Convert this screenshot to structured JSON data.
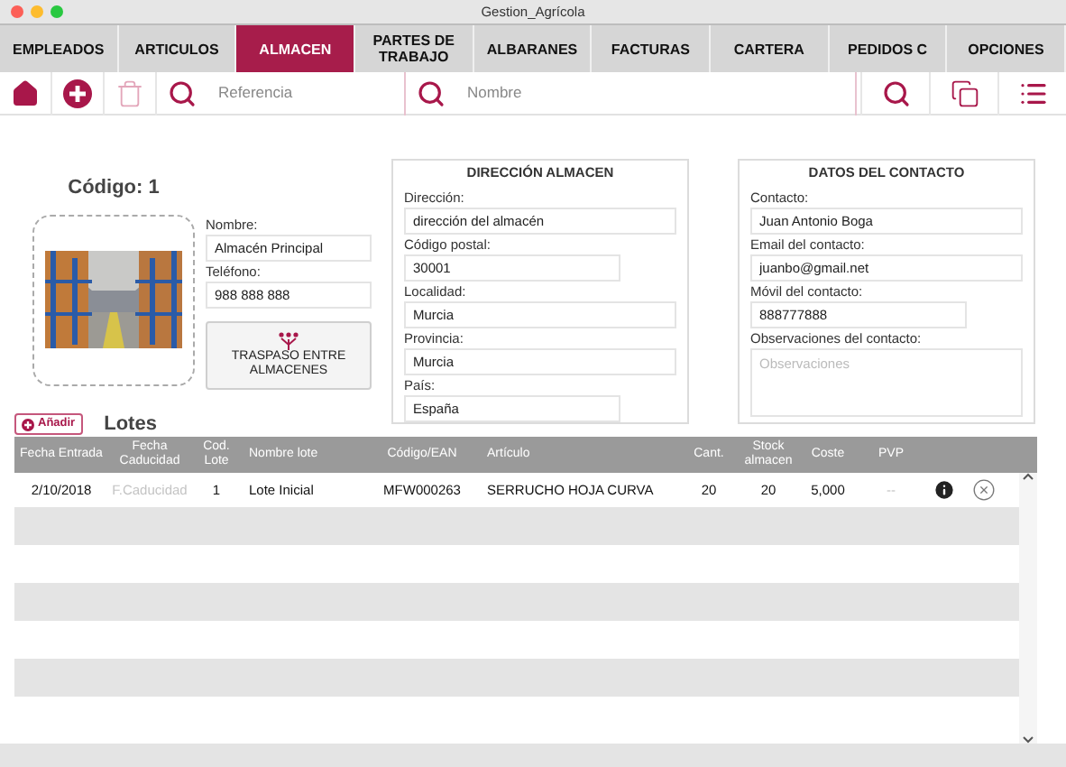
{
  "window": {
    "title": "Gestion_Agrícola"
  },
  "tabs": [
    {
      "label": "EMPLEADOS",
      "selected": false
    },
    {
      "label": "ARTICULOS",
      "selected": false
    },
    {
      "label": "ALMACEN",
      "selected": true
    },
    {
      "label": "PARTES DE TRABAJO",
      "selected": false
    },
    {
      "label": "ALBARANES",
      "selected": false
    },
    {
      "label": "FACTURAS",
      "selected": false
    },
    {
      "label": "CARTERA",
      "selected": false
    },
    {
      "label": "PEDIDOS C",
      "selected": false
    },
    {
      "label": "OPCIONES",
      "selected": false
    }
  ],
  "toolbar": {
    "left_buttons": [
      {
        "kind": "home",
        "disabled": false
      },
      {
        "kind": "add",
        "disabled": false
      },
      {
        "kind": "delete",
        "disabled": true
      }
    ],
    "search_fields": [
      {
        "placeholder": "Referencia"
      },
      {
        "placeholder": "Nombre"
      }
    ],
    "right_buttons": [
      {
        "kind": "search",
        "disabled": false
      },
      {
        "kind": "copy",
        "disabled": false
      },
      {
        "kind": "list",
        "disabled": false
      }
    ]
  },
  "almacen": {
    "code": "Código: 1",
    "fields": [
      {
        "label": "Nombre:",
        "value": "Almacén Principal"
      },
      {
        "label": "Teléfono:",
        "value": "988 888 888"
      }
    ],
    "transfer_button": "TRASPASO ENTRE ALMACENES"
  },
  "direccion": {
    "title": "DIRECCIÓN ALMACEN",
    "fields": [
      {
        "label": "Dirección:",
        "value": "dirección del almacén",
        "kind": "wide"
      },
      {
        "label": "Código postal:",
        "value": "30001",
        "kind": "short"
      },
      {
        "label": "Localidad:",
        "value": "Murcia",
        "kind": "wide"
      },
      {
        "label": "Provincia:",
        "value": "Murcia",
        "kind": "wide"
      },
      {
        "label": "País:",
        "value": "España",
        "kind": "short"
      }
    ]
  },
  "contacto": {
    "title": "DATOS DEL CONTACTO",
    "fields": [
      {
        "label": "Contacto:",
        "value": "Juan Antonio Boga",
        "kind": "wide"
      },
      {
        "label": "Email del contacto:",
        "value": "juanbo@gmail.net",
        "kind": "wide"
      },
      {
        "label": "Móvil del contacto:",
        "value": "888777888",
        "kind": "short"
      },
      {
        "label": "Observaciones del contacto:",
        "placeholder": "Observaciones",
        "kind": "textarea"
      }
    ]
  },
  "lotes": {
    "add_button": "Añadir",
    "title": "Lotes",
    "columns": [
      "Fecha Entrada",
      "Fecha Caducidad",
      "Cod. Lote",
      "Nombre lote",
      "Código/EAN",
      "Artículo",
      "Cant.",
      "Stock almacen",
      "Coste",
      "PVP"
    ],
    "rows": [
      {
        "cells": [
          {
            "text": "2/10/2018",
            "muted": false
          },
          {
            "text": "F.Caducidad",
            "muted": true
          },
          {
            "text": "1",
            "muted": false
          },
          {
            "text": "Lote Inicial",
            "muted": false
          },
          {
            "text": "MFW000263",
            "muted": false
          },
          {
            "text": "SERRUCHO HOJA CURVA",
            "muted": false
          },
          {
            "text": "20",
            "muted": false
          },
          {
            "text": "20",
            "muted": false
          },
          {
            "text": "5,000",
            "muted": false
          },
          {
            "text": "--",
            "muted": true
          }
        ]
      }
    ]
  }
}
